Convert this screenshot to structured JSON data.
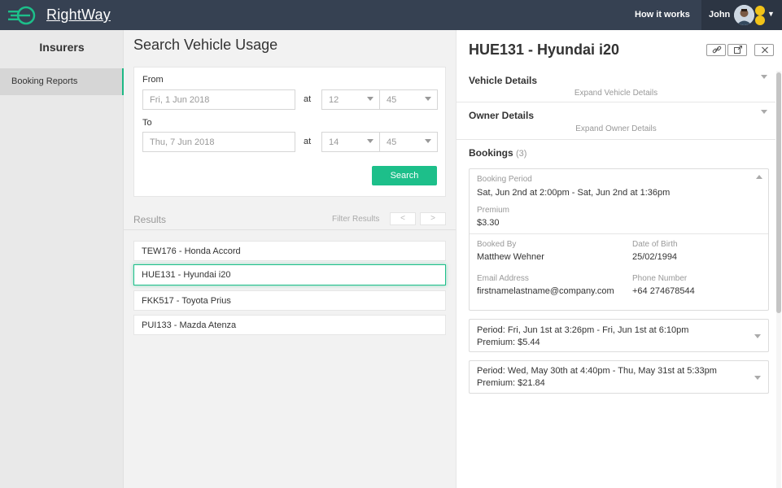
{
  "app": {
    "name": "RightWay"
  },
  "topbar": {
    "how_it_works": "How it works",
    "user_name": "John"
  },
  "sidebar": {
    "title": "Insurers",
    "items": [
      {
        "label": "Booking Reports",
        "active": true
      }
    ]
  },
  "search": {
    "title": "Search Vehicle Usage",
    "from_label": "From",
    "from_date_placeholder": "Fri, 1 Jun 2018",
    "from_hour": "12",
    "from_minute": "45",
    "to_label": "To",
    "to_date_placeholder": "Thu, 7 Jun 2018",
    "to_hour": "14",
    "to_minute": "45",
    "at_label": "at",
    "button_label": "Search"
  },
  "results": {
    "label": "Results",
    "filter_label": "Filter Results",
    "prev": "<",
    "next": ">",
    "items": [
      "TEW176 - Honda Accord",
      "HUE131 - Hyundai i20",
      "FKK517 - Toyota Prius",
      "PUI133 - Mazda Atenza"
    ],
    "selected_index": 1
  },
  "detail": {
    "title": "HUE131 - Hyundai i20",
    "vehicle_details": {
      "title": "Vehicle Details",
      "subtitle": "Expand Vehicle Details"
    },
    "owner_details": {
      "title": "Owner Details",
      "subtitle": "Expand Owner Details"
    },
    "bookings": {
      "title": "Bookings",
      "count": "(3)",
      "expanded": {
        "period_label": "Booking Period",
        "period_value": "Sat, Jun 2nd at 2:00pm - Sat, Jun 2nd at 1:36pm",
        "premium_label": "Premium",
        "premium_value": "$3.30",
        "booked_by_label": "Booked By",
        "booked_by_value": "Matthew Wehner",
        "dob_label": "Date of Birth",
        "dob_value": "25/02/1994",
        "email_label": "Email Address",
        "email_value": "firstnamelastname@company.com",
        "phone_label": "Phone Number",
        "phone_value": "+64 274678544"
      },
      "collapsed": [
        {
          "period": "Period: Fri, Jun 1st at 3:26pm - Fri, Jun 1st at 6:10pm",
          "premium": "Premium: $5.44"
        },
        {
          "period": "Period: Wed, May 30th at 4:40pm - Thu, May 31st at 5:33pm",
          "premium": "Premium: $21.84"
        }
      ]
    }
  },
  "colors": {
    "topbar": "#364152",
    "accent": "#1dbf8a",
    "badge": "#f2c318"
  }
}
